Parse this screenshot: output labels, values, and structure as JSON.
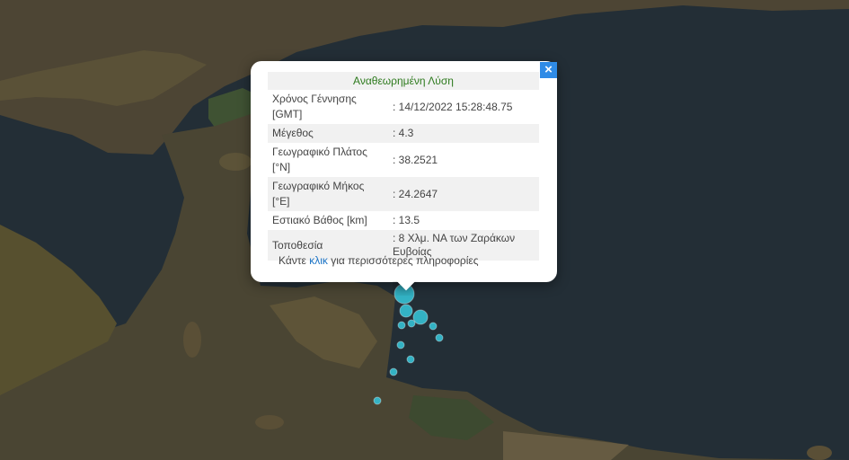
{
  "popup": {
    "title": "Αναθεωρημένη Λύση",
    "close_label": "×",
    "rows": [
      {
        "label": "Χρόνος Γέννησης [GMT]",
        "value": ": 14/12/2022 15:28:48.75"
      },
      {
        "label": "Μέγεθος",
        "value": ": 4.3"
      },
      {
        "label": "Γεωγραφικό Πλάτος [°N]",
        "value": ": 38.2521"
      },
      {
        "label": "Γεωγραφικό Μήκος [°E]",
        "value": ": 24.2647"
      },
      {
        "label": "Εστιακό Βάθος [km]",
        "value": ": 13.5"
      },
      {
        "label": "Τοποθεσία",
        "value": ": 8 Χλμ. ΝΑ των Ζαράκων Ευβοίας"
      }
    ],
    "more_prefix": "Κάντε ",
    "more_link": "κλικ",
    "more_suffix": " για περισσότερες πληροφορίες"
  },
  "colors": {
    "sea": "#232f37",
    "land": "#4e4634",
    "marker": "#35b9cc",
    "title_green": "#2d7a1d",
    "close_blue": "#2f8be6"
  },
  "icons": {
    "close": "close-icon",
    "markers": "earthquake-marker"
  }
}
